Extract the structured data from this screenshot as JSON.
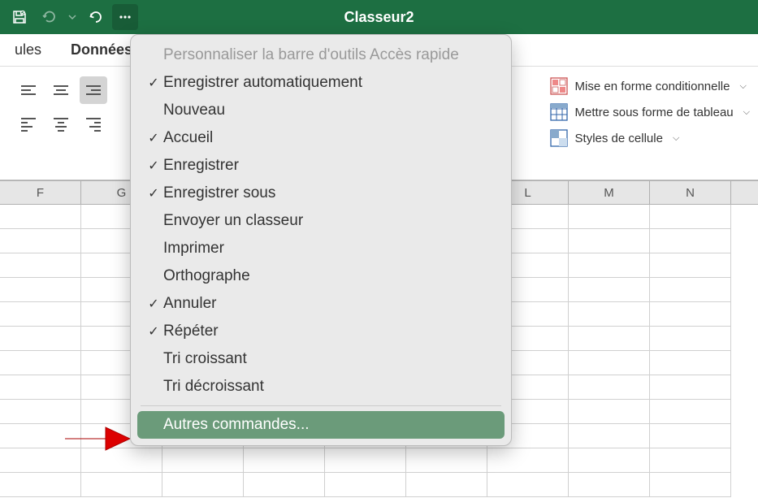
{
  "titlebar": {
    "title": "Classeur2"
  },
  "tabs": {
    "left": "ules",
    "right": "Données"
  },
  "ribbon_right": {
    "conditional": "Mise en forme conditionnelle",
    "table": "Mettre sous forme de tableau",
    "styles": "Styles de cellule"
  },
  "columns": [
    "F",
    "G",
    "",
    "",
    "",
    "",
    "L",
    "M",
    "N"
  ],
  "dropdown": {
    "header": "Personnaliser la barre d'outils Accès rapide",
    "items": [
      {
        "label": "Enregistrer automatiquement",
        "checked": true
      },
      {
        "label": "Nouveau",
        "checked": false
      },
      {
        "label": "Accueil",
        "checked": true
      },
      {
        "label": "Enregistrer",
        "checked": true
      },
      {
        "label": "Enregistrer sous",
        "checked": true
      },
      {
        "label": "Envoyer un classeur",
        "checked": false
      },
      {
        "label": "Imprimer",
        "checked": false
      },
      {
        "label": "Orthographe",
        "checked": false
      },
      {
        "label": "Annuler",
        "checked": true
      },
      {
        "label": "Répéter",
        "checked": true
      },
      {
        "label": "Tri croissant",
        "checked": false
      },
      {
        "label": "Tri décroissant",
        "checked": false
      }
    ],
    "more": "Autres commandes..."
  }
}
